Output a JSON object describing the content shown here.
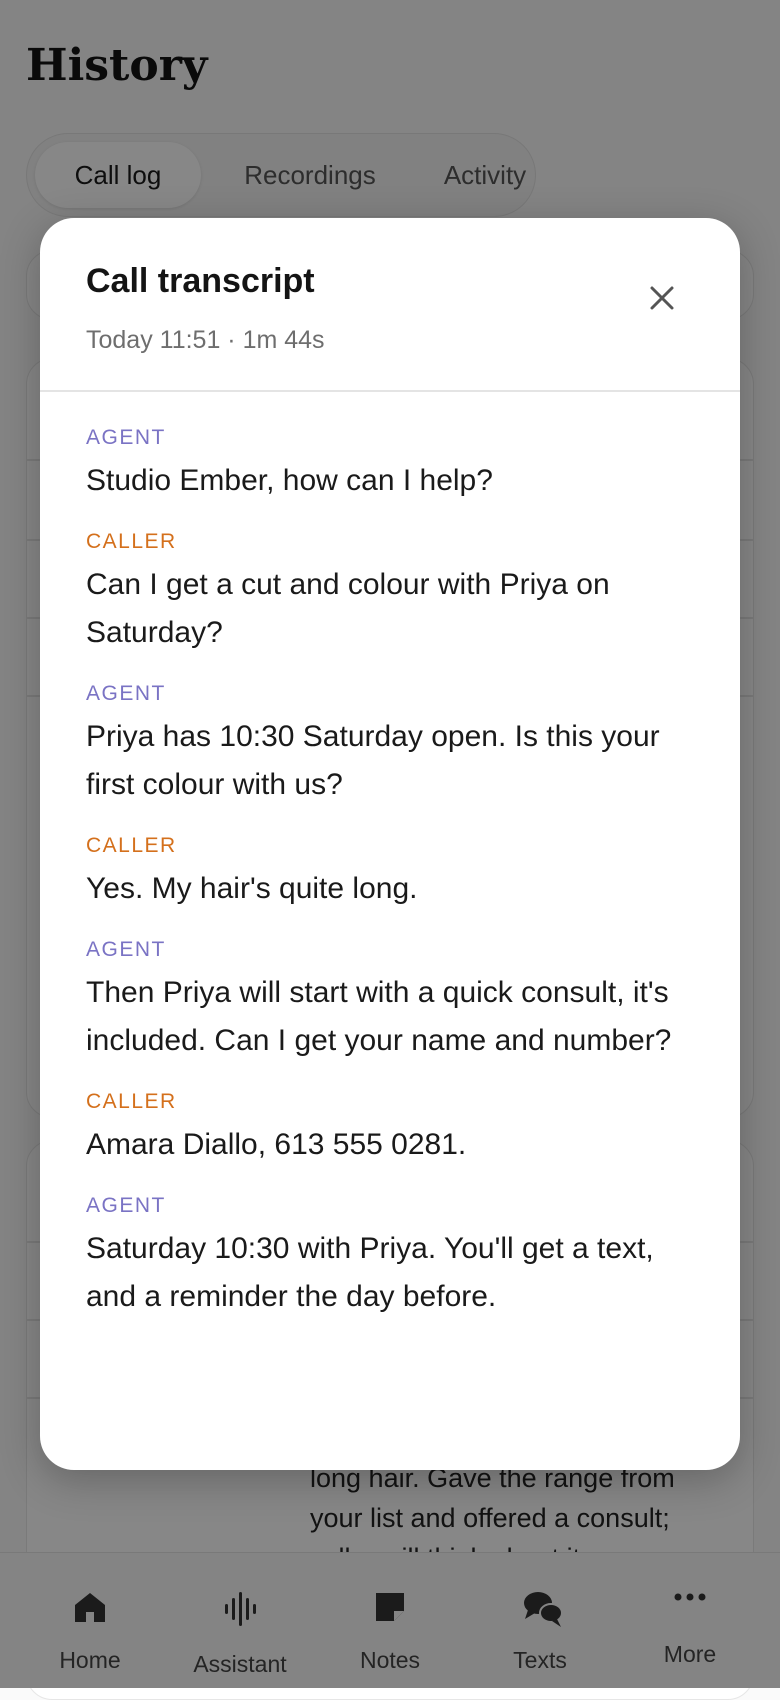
{
  "page": {
    "title": "History",
    "tabs": [
      {
        "label": "Call log",
        "active": true
      },
      {
        "label": "Recordings",
        "active": false
      },
      {
        "label": "Activity",
        "active": false
      }
    ],
    "partial_text": "long hair. Gave the range from your list and offered a consult; caller will think about it."
  },
  "bottom_nav": {
    "items": [
      {
        "label": "Home",
        "icon": "home-icon"
      },
      {
        "label": "Assistant",
        "icon": "waveform-icon"
      },
      {
        "label": "Notes",
        "icon": "note-icon"
      },
      {
        "label": "Texts",
        "icon": "chat-bubbles-icon"
      },
      {
        "label": "More",
        "icon": "more-dots-icon"
      }
    ]
  },
  "modal": {
    "title": "Call transcript",
    "subtitle": "Today 11:51 · 1m 44s",
    "close_icon": "close-icon",
    "turns": [
      {
        "speaker": "AGENT",
        "role": "agent",
        "text": "Studio Ember, how can I help?"
      },
      {
        "speaker": "CALLER",
        "role": "caller",
        "text": "Can I get a cut and colour with Priya on Saturday?"
      },
      {
        "speaker": "AGENT",
        "role": "agent",
        "text": "Priya has 10:30 Saturday open. Is this your first colour with us?"
      },
      {
        "speaker": "CALLER",
        "role": "caller",
        "text": "Yes. My hair's quite long."
      },
      {
        "speaker": "AGENT",
        "role": "agent",
        "text": "Then Priya will start with a quick consult, it's included. Can I get your name and number?"
      },
      {
        "speaker": "CALLER",
        "role": "caller",
        "text": "Amara Diallo, 613 555 0281."
      },
      {
        "speaker": "AGENT",
        "role": "agent",
        "text": "Saturday 10:30 with Priya. You'll get a text, and a reminder the day before."
      }
    ]
  },
  "colors": {
    "agent_label": "#7a73c4",
    "caller_label": "#d4701c",
    "scrim": "rgba(0,0,0,0.47)"
  }
}
